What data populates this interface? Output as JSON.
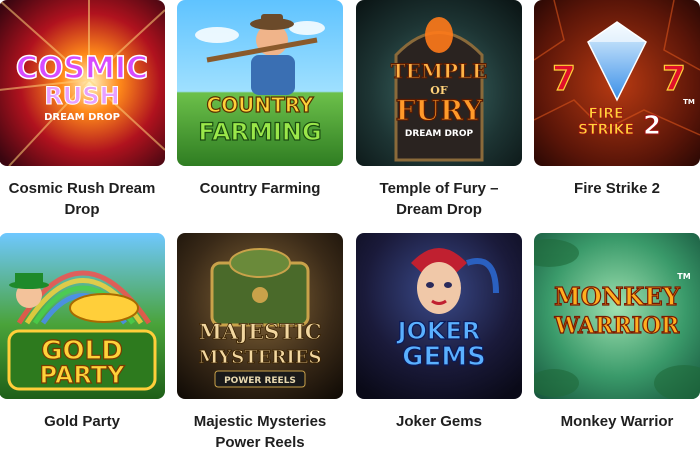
{
  "games": [
    {
      "title": "Cosmic Rush Dream Drop",
      "logo": [
        "COSMIC",
        "RUSH",
        "DREAM DROP"
      ],
      "image": "cosmic-rush-artwork"
    },
    {
      "title": "Country Farming",
      "logo": [
        "COUNTRY",
        "FARMING"
      ],
      "image": "country-farming-artwork"
    },
    {
      "title": "Temple of Fury – Dream Drop",
      "logo": [
        "TEMPLE",
        "OF",
        "FURY",
        "DREAM DROP"
      ],
      "image": "temple-of-fury-artwork"
    },
    {
      "title": "Fire Strike 2",
      "logo": [
        "FIRE",
        "STRIKE",
        "2",
        "TM"
      ],
      "image": "fire-strike-artwork"
    },
    {
      "title": "Gold Party",
      "logo": [
        "GOLD",
        "PARTY"
      ],
      "image": "gold-party-artwork"
    },
    {
      "title": "Majestic Mysteries Power Reels",
      "logo": [
        "MAJESTIC",
        "MYSTERIES",
        "POWER REELS"
      ],
      "image": "majestic-mysteries-artwork"
    },
    {
      "title": "Joker Gems",
      "logo": [
        "JOKER",
        "GEMS"
      ],
      "image": "joker-gems-artwork"
    },
    {
      "title": "Monkey Warrior",
      "logo": [
        "MONKEY",
        "WARRIOR",
        "TM"
      ],
      "image": "monkey-warrior-artwork"
    }
  ],
  "colors": {
    "text": "#1f1f1f",
    "background": "#ffffff"
  }
}
